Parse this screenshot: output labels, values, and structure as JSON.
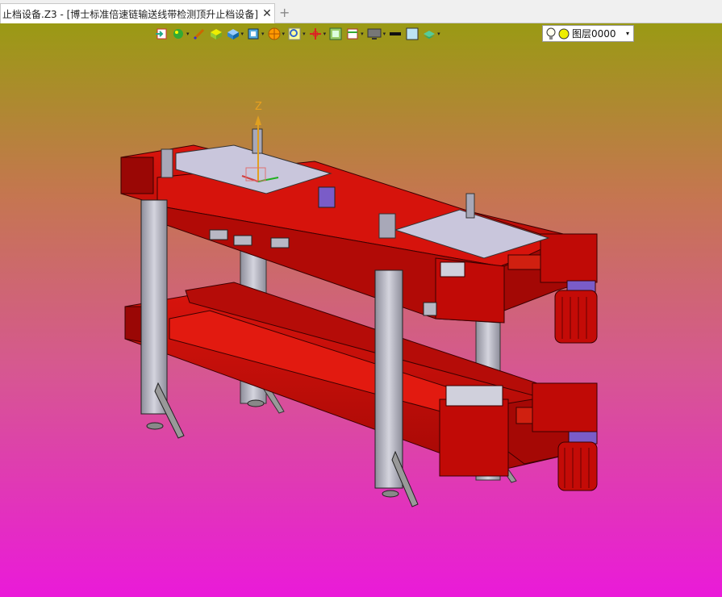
{
  "tab": {
    "title": "止档设备.Z3 - [博士标准倍速链输送线带检测顶升止档设备]",
    "close_glyph": "✕",
    "new_tab_glyph": "+"
  },
  "toolbar": {
    "icons": [
      "import-icon",
      "paint-icon",
      "brush-icon",
      "box-icon",
      "cube-icon",
      "view-cube-icon",
      "render-icon",
      "zoom-icon",
      "axis-icon",
      "frame-icon",
      "display-icon",
      "monitor-icon",
      "line-color-icon",
      "face-color-icon",
      "layer-style-icon"
    ],
    "layer_value": "图层0000",
    "dropdown_glyph": "▾"
  },
  "triad": {
    "z_label": "Z"
  },
  "colors": {
    "frame_red": "#c10a06",
    "dark_red": "#8a0404",
    "steel": "#b8b8c4",
    "plate": "#c9c6dc",
    "bg_top": "#9a9a14",
    "bg_bottom": "#ea1ad9"
  }
}
